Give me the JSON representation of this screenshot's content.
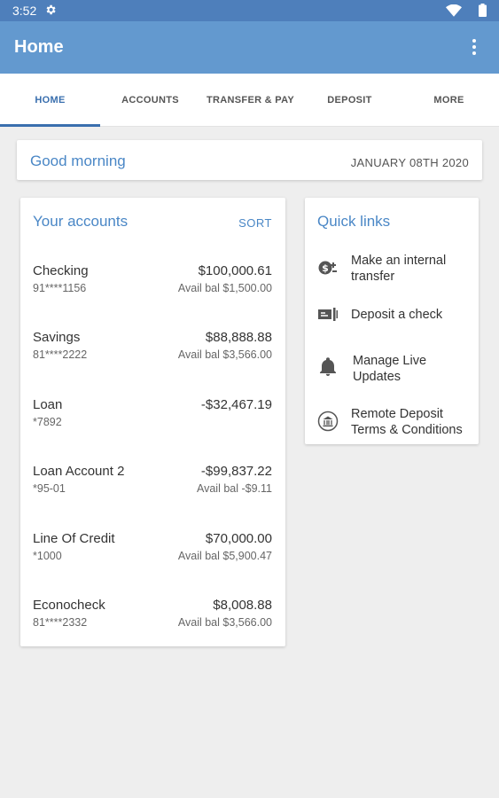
{
  "status": {
    "time": "3:52"
  },
  "app": {
    "title": "Home"
  },
  "tabs": [
    {
      "label": "HOME"
    },
    {
      "label": "ACCOUNTS"
    },
    {
      "label": "TRANSFER & PAY"
    },
    {
      "label": "DEPOSIT"
    },
    {
      "label": "MORE"
    }
  ],
  "greeting": {
    "text": "Good morning",
    "date": "JANUARY 08TH 2020"
  },
  "accounts": {
    "heading": "Your accounts",
    "sort_label": "SORT",
    "items": [
      {
        "name": "Checking",
        "number": "91****1156",
        "balance": "$100,000.61",
        "avail": "Avail bal $1,500.00"
      },
      {
        "name": "Savings",
        "number": "81****2222",
        "balance": "$88,888.88",
        "avail": "Avail bal $3,566.00"
      },
      {
        "name": "Loan",
        "number": "*7892",
        "balance": "-$32,467.19",
        "avail": ""
      },
      {
        "name": "Loan Account 2",
        "number": "*95-01",
        "balance": "-$99,837.22",
        "avail": "Avail bal -$9.11"
      },
      {
        "name": "Line Of Credit",
        "number": "*1000",
        "balance": "$70,000.00",
        "avail": "Avail bal $5,900.47"
      },
      {
        "name": "Econocheck",
        "number": "81****2332",
        "balance": "$8,008.88",
        "avail": "Avail bal $3,566.00"
      }
    ]
  },
  "quick_links": {
    "heading": "Quick links",
    "items": [
      {
        "label": "Make an internal transfer",
        "icon": "transfer-icon"
      },
      {
        "label": "Deposit a check",
        "icon": "check-icon"
      },
      {
        "label": "Manage Live Updates",
        "icon": "bell-icon"
      },
      {
        "label": "Remote Deposit Terms & Conditions",
        "icon": "bank-icon"
      }
    ]
  },
  "colors": {
    "status_bar": "#4e7fbb",
    "app_bar": "#6399cf",
    "accent": "#3a6fae",
    "link": "#4a87c6",
    "background": "#eeeeee"
  }
}
